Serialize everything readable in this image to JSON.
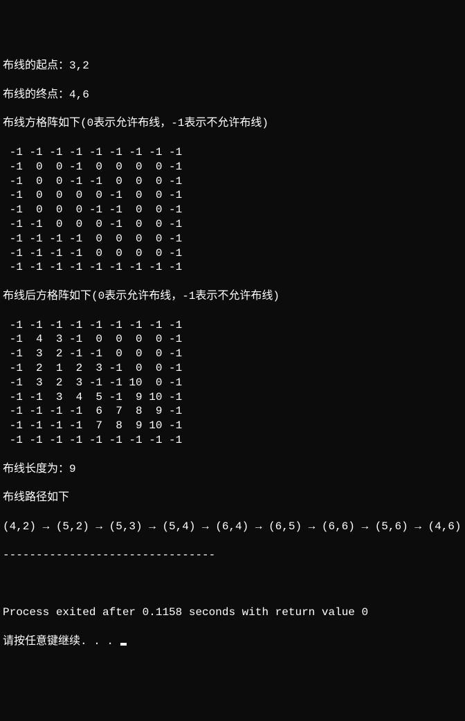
{
  "start_label": "布线的起点：",
  "start_value": "3,2",
  "end_label": "布线的终点：",
  "end_value": "4,6",
  "grid_before_label": "布线方格阵如下(0表示允许布线，-1表示不允许布线)",
  "grid_before": [
    [
      -1,
      -1,
      -1,
      -1,
      -1,
      -1,
      -1,
      -1,
      -1
    ],
    [
      -1,
      0,
      0,
      -1,
      0,
      0,
      0,
      0,
      -1
    ],
    [
      -1,
      0,
      0,
      -1,
      -1,
      0,
      0,
      0,
      -1
    ],
    [
      -1,
      0,
      0,
      0,
      0,
      -1,
      0,
      0,
      -1
    ],
    [
      -1,
      0,
      0,
      0,
      -1,
      -1,
      0,
      0,
      -1
    ],
    [
      -1,
      -1,
      0,
      0,
      0,
      -1,
      0,
      0,
      -1
    ],
    [
      -1,
      -1,
      -1,
      -1,
      0,
      0,
      0,
      0,
      -1
    ],
    [
      -1,
      -1,
      -1,
      -1,
      0,
      0,
      0,
      0,
      -1
    ],
    [
      -1,
      -1,
      -1,
      -1,
      -1,
      -1,
      -1,
      -1,
      -1
    ]
  ],
  "grid_after_label": "布线后方格阵如下(0表示允许布线，-1表示不允许布线)",
  "grid_after": [
    [
      -1,
      -1,
      -1,
      -1,
      -1,
      -1,
      -1,
      -1,
      -1
    ],
    [
      -1,
      4,
      3,
      -1,
      0,
      0,
      0,
      0,
      -1
    ],
    [
      -1,
      3,
      2,
      -1,
      -1,
      0,
      0,
      0,
      -1
    ],
    [
      -1,
      2,
      1,
      2,
      3,
      -1,
      0,
      0,
      -1
    ],
    [
      -1,
      3,
      2,
      3,
      -1,
      -1,
      10,
      0,
      -1
    ],
    [
      -1,
      -1,
      3,
      4,
      5,
      -1,
      9,
      10,
      -1
    ],
    [
      -1,
      -1,
      -1,
      -1,
      6,
      7,
      8,
      9,
      -1
    ],
    [
      -1,
      -1,
      -1,
      -1,
      7,
      8,
      9,
      10,
      -1
    ],
    [
      -1,
      -1,
      -1,
      -1,
      -1,
      -1,
      -1,
      -1,
      -1
    ]
  ],
  "length_label": "布线长度为：",
  "length_value": "9",
  "path_label": "布线路径如下",
  "path": [
    "(4,2)",
    "(5,2)",
    "(5,3)",
    "(5,4)",
    "(6,4)",
    "(6,5)",
    "(6,6)",
    "(5,6)",
    "(4,6)"
  ],
  "arrow": "→",
  "divider": "--------------------------------",
  "process_exit_prefix": "Process exited after ",
  "process_exit_time": "0.1158",
  "process_exit_mid": " seconds with return value ",
  "process_exit_code": "0",
  "press_key": "请按任意键继续. . . "
}
